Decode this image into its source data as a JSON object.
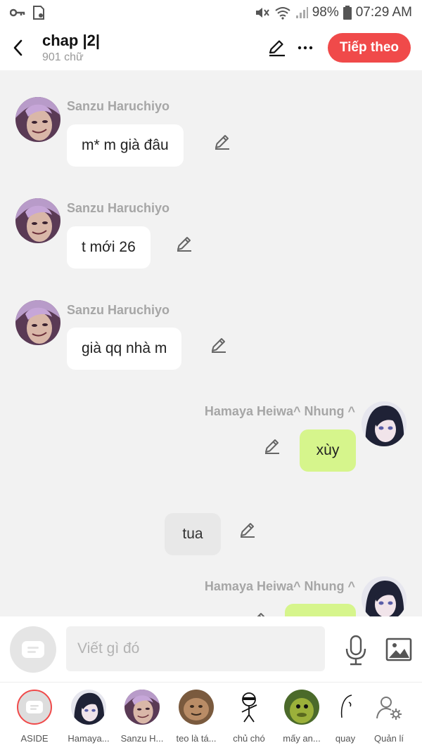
{
  "status_bar": {
    "battery": "98%",
    "time": "07:29 AM"
  },
  "header": {
    "title": "chap |2|",
    "subtitle": "901 chữ",
    "next_label": "Tiếp theo"
  },
  "messages": [
    {
      "sender": "Sanzu Haruchiyo",
      "text": "m* m già đâu"
    },
    {
      "sender": "Sanzu Haruchiyo",
      "text": "t mới 26"
    },
    {
      "sender": "Sanzu Haruchiyo",
      "text": "già qq nhà m"
    },
    {
      "sender": "Hamaya Heiwa^ Nhung ^",
      "text": "xùy"
    },
    {
      "sender": "",
      "text": "tua"
    },
    {
      "sender": "Hamaya Heiwa^ Nhung ^",
      "text": ""
    }
  ],
  "input": {
    "placeholder": "Viết gì đó"
  },
  "characters": [
    {
      "label": "ASIDE"
    },
    {
      "label": "Hamaya..."
    },
    {
      "label": "Sanzu H..."
    },
    {
      "label": "teo là tá..."
    },
    {
      "label": "chủ chó"
    },
    {
      "label": "mấy an..."
    },
    {
      "label": "quay"
    },
    {
      "label": "Quản lí"
    }
  ],
  "colors": {
    "accent": "#f04a4a",
    "mine_bubble": "#d6f58c",
    "bubble": "#ffffff"
  }
}
